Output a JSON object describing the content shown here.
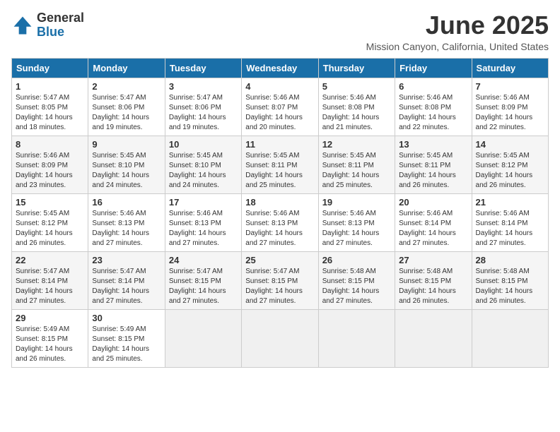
{
  "logo": {
    "general": "General",
    "blue": "Blue"
  },
  "header": {
    "month_title": "June 2025",
    "subtitle": "Mission Canyon, California, United States"
  },
  "weekdays": [
    "Sunday",
    "Monday",
    "Tuesday",
    "Wednesday",
    "Thursday",
    "Friday",
    "Saturday"
  ],
  "weeks": [
    [
      {
        "day": "1",
        "sunrise": "5:47 AM",
        "sunset": "8:05 PM",
        "daylight": "14 hours and 18 minutes."
      },
      {
        "day": "2",
        "sunrise": "5:47 AM",
        "sunset": "8:06 PM",
        "daylight": "14 hours and 19 minutes."
      },
      {
        "day": "3",
        "sunrise": "5:47 AM",
        "sunset": "8:06 PM",
        "daylight": "14 hours and 19 minutes."
      },
      {
        "day": "4",
        "sunrise": "5:46 AM",
        "sunset": "8:07 PM",
        "daylight": "14 hours and 20 minutes."
      },
      {
        "day": "5",
        "sunrise": "5:46 AM",
        "sunset": "8:08 PM",
        "daylight": "14 hours and 21 minutes."
      },
      {
        "day": "6",
        "sunrise": "5:46 AM",
        "sunset": "8:08 PM",
        "daylight": "14 hours and 22 minutes."
      },
      {
        "day": "7",
        "sunrise": "5:46 AM",
        "sunset": "8:09 PM",
        "daylight": "14 hours and 22 minutes."
      }
    ],
    [
      {
        "day": "8",
        "sunrise": "5:46 AM",
        "sunset": "8:09 PM",
        "daylight": "14 hours and 23 minutes."
      },
      {
        "day": "9",
        "sunrise": "5:45 AM",
        "sunset": "8:10 PM",
        "daylight": "14 hours and 24 minutes."
      },
      {
        "day": "10",
        "sunrise": "5:45 AM",
        "sunset": "8:10 PM",
        "daylight": "14 hours and 24 minutes."
      },
      {
        "day": "11",
        "sunrise": "5:45 AM",
        "sunset": "8:11 PM",
        "daylight": "14 hours and 25 minutes."
      },
      {
        "day": "12",
        "sunrise": "5:45 AM",
        "sunset": "8:11 PM",
        "daylight": "14 hours and 25 minutes."
      },
      {
        "day": "13",
        "sunrise": "5:45 AM",
        "sunset": "8:11 PM",
        "daylight": "14 hours and 26 minutes."
      },
      {
        "day": "14",
        "sunrise": "5:45 AM",
        "sunset": "8:12 PM",
        "daylight": "14 hours and 26 minutes."
      }
    ],
    [
      {
        "day": "15",
        "sunrise": "5:45 AM",
        "sunset": "8:12 PM",
        "daylight": "14 hours and 26 minutes."
      },
      {
        "day": "16",
        "sunrise": "5:46 AM",
        "sunset": "8:13 PM",
        "daylight": "14 hours and 27 minutes."
      },
      {
        "day": "17",
        "sunrise": "5:46 AM",
        "sunset": "8:13 PM",
        "daylight": "14 hours and 27 minutes."
      },
      {
        "day": "18",
        "sunrise": "5:46 AM",
        "sunset": "8:13 PM",
        "daylight": "14 hours and 27 minutes."
      },
      {
        "day": "19",
        "sunrise": "5:46 AM",
        "sunset": "8:13 PM",
        "daylight": "14 hours and 27 minutes."
      },
      {
        "day": "20",
        "sunrise": "5:46 AM",
        "sunset": "8:14 PM",
        "daylight": "14 hours and 27 minutes."
      },
      {
        "day": "21",
        "sunrise": "5:46 AM",
        "sunset": "8:14 PM",
        "daylight": "14 hours and 27 minutes."
      }
    ],
    [
      {
        "day": "22",
        "sunrise": "5:47 AM",
        "sunset": "8:14 PM",
        "daylight": "14 hours and 27 minutes."
      },
      {
        "day": "23",
        "sunrise": "5:47 AM",
        "sunset": "8:14 PM",
        "daylight": "14 hours and 27 minutes."
      },
      {
        "day": "24",
        "sunrise": "5:47 AM",
        "sunset": "8:15 PM",
        "daylight": "14 hours and 27 minutes."
      },
      {
        "day": "25",
        "sunrise": "5:47 AM",
        "sunset": "8:15 PM",
        "daylight": "14 hours and 27 minutes."
      },
      {
        "day": "26",
        "sunrise": "5:48 AM",
        "sunset": "8:15 PM",
        "daylight": "14 hours and 27 minutes."
      },
      {
        "day": "27",
        "sunrise": "5:48 AM",
        "sunset": "8:15 PM",
        "daylight": "14 hours and 26 minutes."
      },
      {
        "day": "28",
        "sunrise": "5:48 AM",
        "sunset": "8:15 PM",
        "daylight": "14 hours and 26 minutes."
      }
    ],
    [
      {
        "day": "29",
        "sunrise": "5:49 AM",
        "sunset": "8:15 PM",
        "daylight": "14 hours and 26 minutes."
      },
      {
        "day": "30",
        "sunrise": "5:49 AM",
        "sunset": "8:15 PM",
        "daylight": "14 hours and 25 minutes."
      },
      null,
      null,
      null,
      null,
      null
    ]
  ]
}
